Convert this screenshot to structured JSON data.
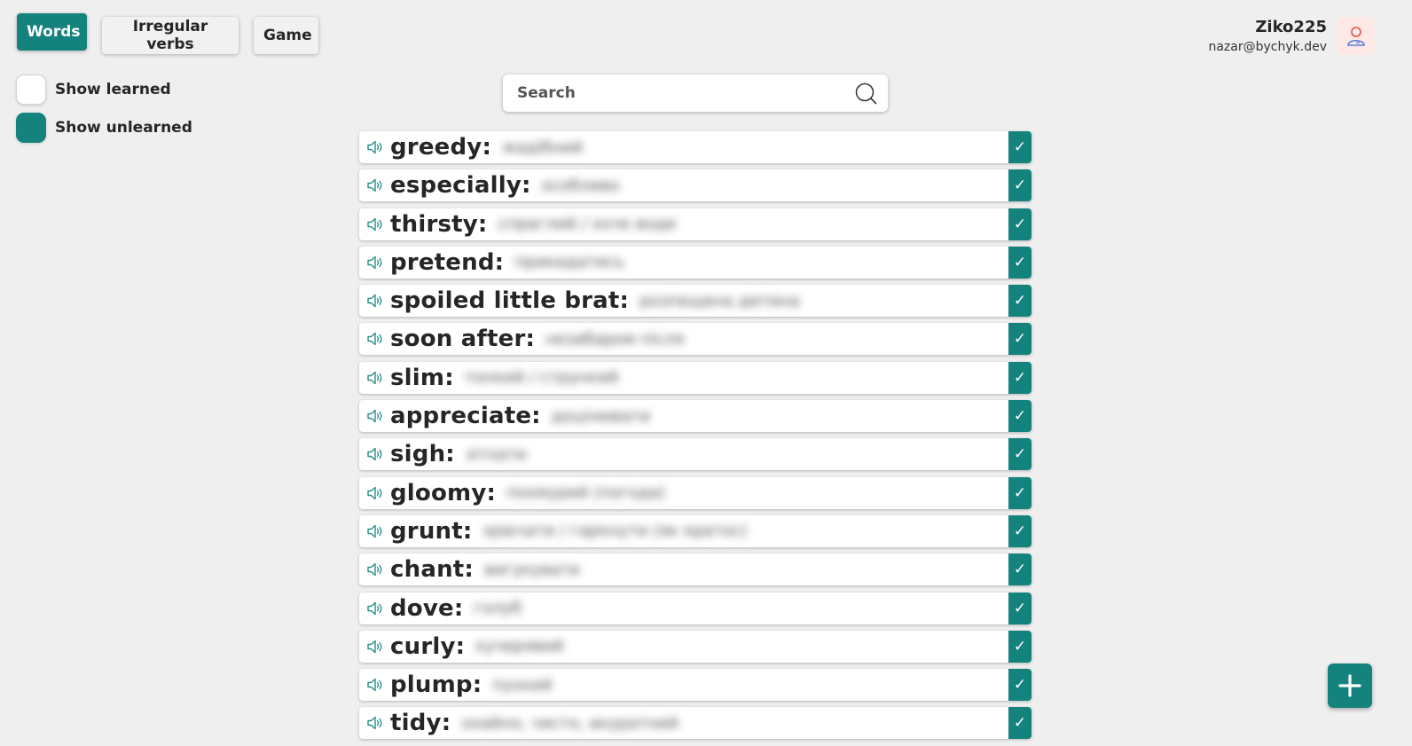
{
  "nav": {
    "words_label": "Words",
    "irregular_label": "Irregular verbs",
    "game_label": "Game"
  },
  "filters": {
    "show_learned": {
      "label": "Show learned",
      "checked": false
    },
    "show_unlearned": {
      "label": "Show unlearned",
      "checked": true
    }
  },
  "user": {
    "name": "Ziko225",
    "email": "nazar@bychyk.dev",
    "avatar_icon": "user-icon"
  },
  "search": {
    "placeholder": "Search",
    "value": "",
    "icon": "search-icon"
  },
  "words": [
    {
      "term": "greedy:",
      "translation": "жадібний"
    },
    {
      "term": "especially:",
      "translation": "особливо"
    },
    {
      "term": "thirsty:",
      "translation": "спраглий / хоче води"
    },
    {
      "term": "pretend:",
      "translation": "прикидатись"
    },
    {
      "term": "spoiled little brat:",
      "translation": "розпещена дитина"
    },
    {
      "term": "soon after:",
      "translation": "незабаром після"
    },
    {
      "term": "slim:",
      "translation": "тонкий / стрункий"
    },
    {
      "term": "appreciate:",
      "translation": "доцінювати"
    },
    {
      "term": "sigh:",
      "translation": "зітхати"
    },
    {
      "term": "gloomy:",
      "translation": "похмурий (погода)"
    },
    {
      "term": "grunt:",
      "translation": "хрючати / гаркнути (як кратос)"
    },
    {
      "term": "chant:",
      "translation": "вигукувати"
    },
    {
      "term": "dove:",
      "translation": "голуб"
    },
    {
      "term": "curly:",
      "translation": "кучерявий"
    },
    {
      "term": "plump:",
      "translation": "пухкий"
    },
    {
      "term": "tidy:",
      "translation": "охайно, чисто, акуратний"
    }
  ],
  "learn_mark": "✓",
  "colors": {
    "accent": "#14827d",
    "background": "#efefef",
    "avatar_bg": "#fde8e6"
  },
  "add_button_icon": "plus-icon"
}
